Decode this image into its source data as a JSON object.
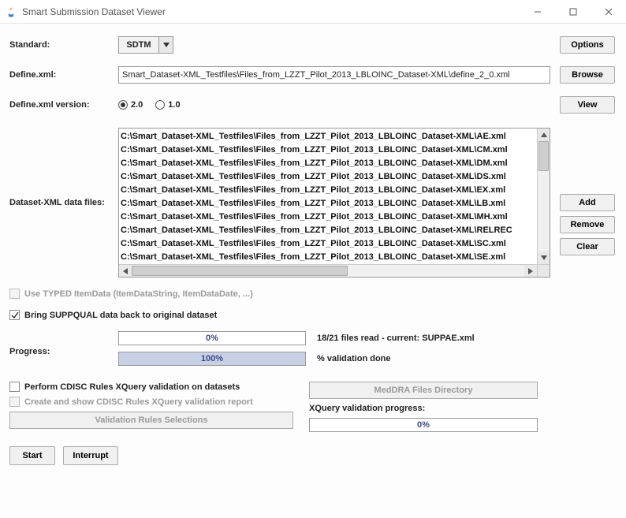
{
  "window": {
    "title": "Smart Submission Dataset Viewer"
  },
  "labels": {
    "standard": "Standard:",
    "define": "Define.xml:",
    "define_version": "Define.xml version:",
    "data_files": "Dataset-XML data files:",
    "progress": "Progress:"
  },
  "standard_combo": {
    "value": "SDTM"
  },
  "define_path": "Smart_Dataset-XML_Testfiles\\Files_from_LZZT_Pilot_2013_LBLOINC_Dataset-XML\\define_2_0.xml",
  "version_options": {
    "v20": "2.0",
    "v10": "1.0",
    "selected": "2.0"
  },
  "buttons": {
    "options": "Options",
    "browse": "Browse",
    "view": "View",
    "add": "Add",
    "remove": "Remove",
    "clear": "Clear",
    "start": "Start",
    "interrupt": "Interrupt",
    "validation_rules": "Validation Rules Selections",
    "meddra_dir": "MedDRA Files Directory"
  },
  "file_list": [
    "C:\\Smart_Dataset-XML_Testfiles\\Files_from_LZZT_Pilot_2013_LBLOINC_Dataset-XML\\AE.xml",
    "C:\\Smart_Dataset-XML_Testfiles\\Files_from_LZZT_Pilot_2013_LBLOINC_Dataset-XML\\CM.xml",
    "C:\\Smart_Dataset-XML_Testfiles\\Files_from_LZZT_Pilot_2013_LBLOINC_Dataset-XML\\DM.xml",
    "C:\\Smart_Dataset-XML_Testfiles\\Files_from_LZZT_Pilot_2013_LBLOINC_Dataset-XML\\DS.xml",
    "C:\\Smart_Dataset-XML_Testfiles\\Files_from_LZZT_Pilot_2013_LBLOINC_Dataset-XML\\EX.xml",
    "C:\\Smart_Dataset-XML_Testfiles\\Files_from_LZZT_Pilot_2013_LBLOINC_Dataset-XML\\LB.xml",
    "C:\\Smart_Dataset-XML_Testfiles\\Files_from_LZZT_Pilot_2013_LBLOINC_Dataset-XML\\MH.xml",
    "C:\\Smart_Dataset-XML_Testfiles\\Files_from_LZZT_Pilot_2013_LBLOINC_Dataset-XML\\RELREC",
    "C:\\Smart_Dataset-XML_Testfiles\\Files_from_LZZT_Pilot_2013_LBLOINC_Dataset-XML\\SC.xml",
    "C:\\Smart_Dataset-XML_Testfiles\\Files_from_LZZT_Pilot_2013_LBLOINC_Dataset-XML\\SE.xml"
  ],
  "checkboxes": {
    "typed_itemdata": "Use TYPED ItemData (ItemDataString, ItemDataDate, ...)",
    "suppqual": "Bring SUPPQUAL data back to original dataset",
    "perform_xquery": "Perform CDISC Rules XQuery validation on datasets",
    "create_report": "Create and show CDISC Rules XQuery validation report"
  },
  "progress": {
    "files_pct": "0%",
    "files_pct_value": 0,
    "files_status": "18/21 files read - current: SUPPAE.xml",
    "validation_pct": "100%",
    "validation_pct_value": 100,
    "validation_label": "% validation done",
    "xquery_label": "XQuery validation progress:",
    "xquery_pct": "0%",
    "xquery_pct_value": 0
  }
}
